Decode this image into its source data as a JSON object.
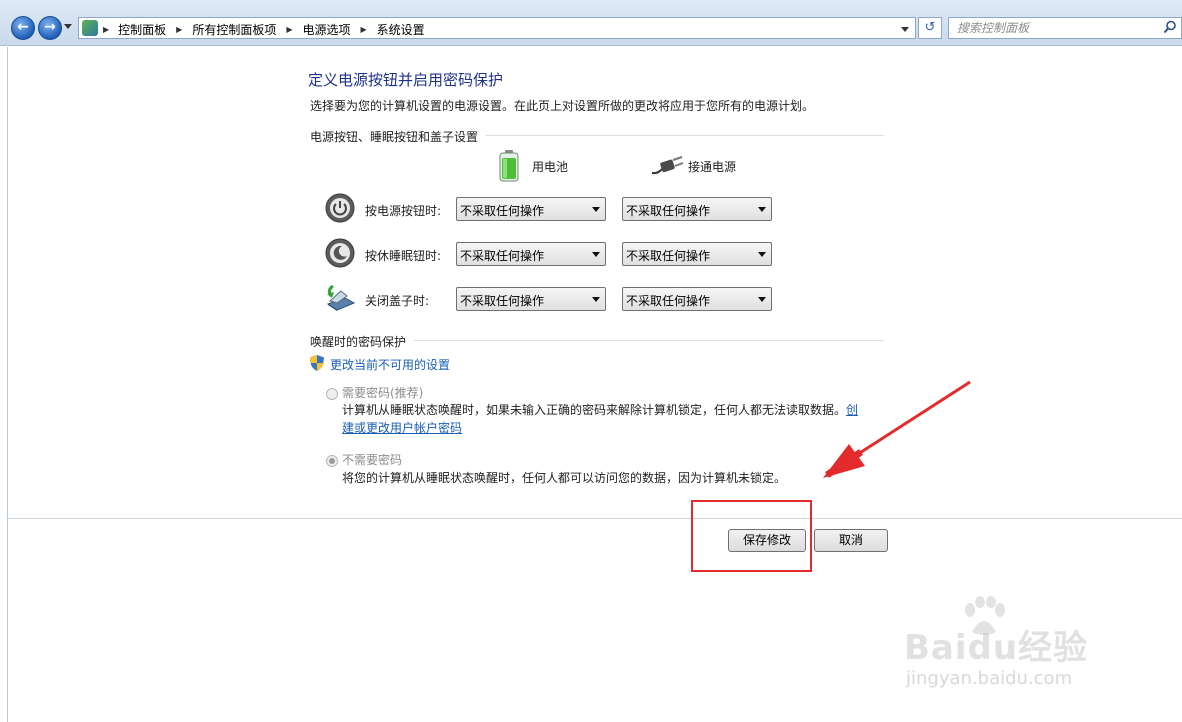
{
  "address_bar": {
    "breadcrumbs": [
      "控制面板",
      "所有控制面板项",
      "电源选项",
      "系统设置"
    ],
    "search_placeholder": "搜索控制面板"
  },
  "page": {
    "title": "定义电源按钮并启用密码保护",
    "description": "选择要为您的计算机设置的电源设置。在此页上对设置所做的更改将应用于您所有的电源计划。"
  },
  "power_settings": {
    "section_title": "电源按钮、睡眠按钮和盖子设置",
    "battery_label": "用电池",
    "plugged_label": "接通电源",
    "rows": [
      {
        "label": "按电源按钮时:",
        "battery_value": "不采取任何操作",
        "plugged_value": "不采取任何操作"
      },
      {
        "label": "按休睡眠钮时:",
        "battery_value": "不采取任何操作",
        "plugged_value": "不采取任何操作"
      },
      {
        "label": "关闭盖子时:",
        "battery_value": "不采取任何操作",
        "plugged_value": "不采取任何操作"
      }
    ]
  },
  "password_protection": {
    "section_title": "唤醒时的密码保护",
    "change_link": "更改当前不可用的设置",
    "option_require": {
      "label": "需要密码(推荐)",
      "desc": "计算机从睡眠状态唤醒时，如果未输入正确的密码来解除计算机锁定，任何人都无法读取数据。",
      "link_part1": "创",
      "link_part2": "建或更改用户帐户密码",
      "selected": false
    },
    "option_none": {
      "label": "不需要密码",
      "desc": "将您的计算机从睡眠状态唤醒时，任何人都可以访问您的数据，因为计算机未锁定。",
      "selected": true
    }
  },
  "buttons": {
    "save": "保存修改",
    "cancel": "取消"
  },
  "annotation": {
    "color": "#e32b2b"
  },
  "watermark": {
    "brand": "Baidu经验",
    "url": "jingyan.baidu.com"
  }
}
